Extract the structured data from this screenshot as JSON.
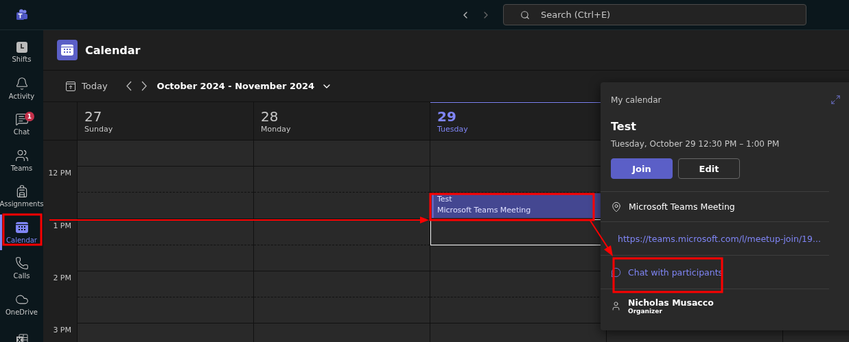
{
  "top_bar": {
    "search": {
      "placeholder": "Search (Ctrl+E)"
    }
  },
  "rail": [
    {
      "label": "Shifts",
      "selected": false
    },
    {
      "label": "Activity",
      "selected": false
    },
    {
      "label": "Chat",
      "selected": false,
      "badge": "1"
    },
    {
      "label": "Teams",
      "selected": false
    },
    {
      "label": "Assignments",
      "selected": false
    },
    {
      "label": "Calendar",
      "selected": true
    },
    {
      "label": "Calls",
      "selected": false
    },
    {
      "label": "OneDrive",
      "selected": false
    }
  ],
  "page": {
    "title": "Calendar"
  },
  "toolbar": {
    "today": "Today",
    "range": "October 2024 - November 2024"
  },
  "days": [
    {
      "number": "27",
      "weekday": "Sunday",
      "selected": false
    },
    {
      "number": "28",
      "weekday": "Monday",
      "selected": false
    },
    {
      "number": "29",
      "weekday": "Tuesday",
      "selected": true,
      "events": [
        {
          "title": "Test",
          "subtitle": "Microsoft Teams Meeting"
        }
      ]
    }
  ],
  "hours": [
    "12 PM",
    "1 PM",
    "2 PM",
    "3 PM"
  ],
  "popup": {
    "calendar": "My calendar",
    "title": "Test",
    "when": "Tuesday, October 29 12:30 PM – 1:00 PM",
    "buttons": [
      {
        "label": "Join",
        "kind": "primary"
      },
      {
        "label": "Edit",
        "kind": "secondary"
      }
    ],
    "location": "Microsoft Teams Meeting",
    "link": "https://teams.microsoft.com/l/meetup-join/19...",
    "chat": "Chat with participants",
    "organizer": {
      "name": "Nicholas Musacco",
      "role": "Organizer"
    }
  }
}
